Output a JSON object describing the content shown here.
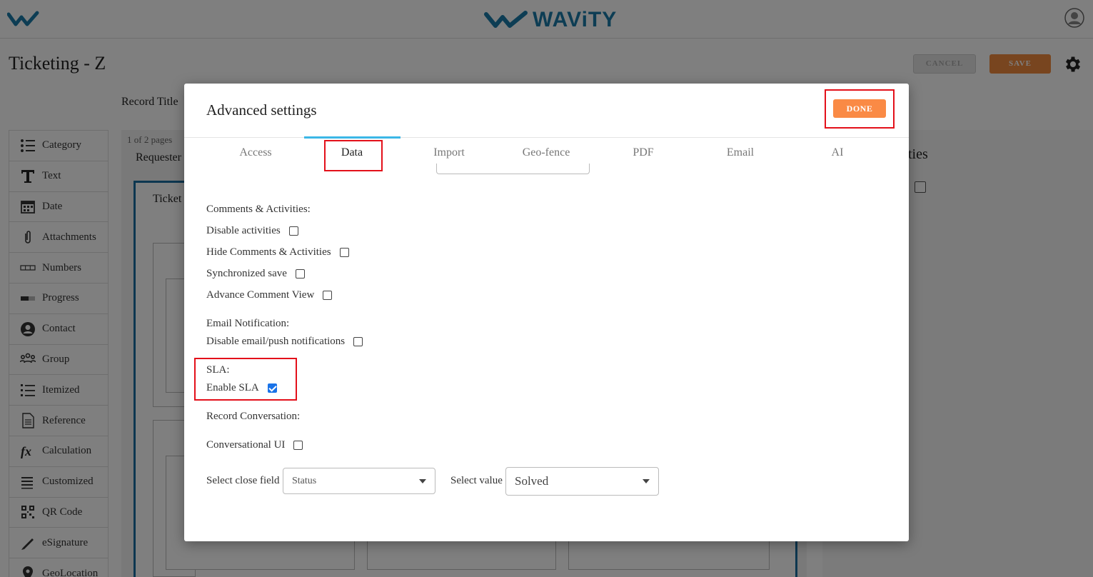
{
  "app": {
    "brand": "WAViTY",
    "page_title": "Ticketing - Z",
    "cancel_label": "CANCEL",
    "save_label": "SAVE",
    "record_title_label": "Record Title",
    "pages_label": "1 of 2 pages",
    "requester_label": "Requester",
    "ticket_label": "Ticket",
    "right_panel_heading": "ties"
  },
  "sidebar": {
    "items": [
      {
        "label": "Category",
        "icon": "list-icon"
      },
      {
        "label": "Text",
        "icon": "text-t-icon"
      },
      {
        "label": "Date",
        "icon": "calendar-icon"
      },
      {
        "label": "Attachments",
        "icon": "paperclip-icon"
      },
      {
        "label": "Numbers",
        "icon": "numbers-icon"
      },
      {
        "label": "Progress",
        "icon": "progress-icon"
      },
      {
        "label": "Contact",
        "icon": "contact-icon"
      },
      {
        "label": "Group",
        "icon": "group-icon"
      },
      {
        "label": "Itemized",
        "icon": "itemized-icon"
      },
      {
        "label": "Reference",
        "icon": "document-icon"
      },
      {
        "label": "Calculation",
        "icon": "function-icon"
      },
      {
        "label": "Customized",
        "icon": "menu-icon"
      },
      {
        "label": "QR Code",
        "icon": "qr-code-icon"
      },
      {
        "label": "eSignature",
        "icon": "pen-icon"
      },
      {
        "label": "GeoLocation",
        "icon": "location-pin-icon"
      }
    ]
  },
  "modal": {
    "title": "Advanced settings",
    "done_label": "DONE",
    "tabs": [
      {
        "label": "Access"
      },
      {
        "label": "Data"
      },
      {
        "label": "Import"
      },
      {
        "label": "Geo-fence"
      },
      {
        "label": "PDF"
      },
      {
        "label": "Email"
      },
      {
        "label": "AI"
      }
    ],
    "active_tab": "Data",
    "comments_section": "Comments & Activities:",
    "disable_activities": "Disable activities",
    "hide_comments": "Hide Comments & Activities",
    "synchronized_save": "Synchronized save",
    "advance_comment_view": "Advance Comment View",
    "email_section": "Email Notification:",
    "disable_email": "Disable email/push notifications",
    "sla_section": "SLA:",
    "enable_sla": "Enable SLA",
    "enable_sla_checked": true,
    "record_conversation_section": "Record Conversation:",
    "conversational_ui": "Conversational UI",
    "select_close_field_label": "Select close field",
    "select_close_field_value": "Status",
    "select_value_label": "Select value",
    "select_value_value": "Solved"
  },
  "colors": {
    "accent_orange": "#fa8a45",
    "brand_blue": "#1a7ba8",
    "tab_underline": "#3bb7e6",
    "highlight_red": "#e3101a",
    "checkbox_blue": "#1a73e8"
  }
}
